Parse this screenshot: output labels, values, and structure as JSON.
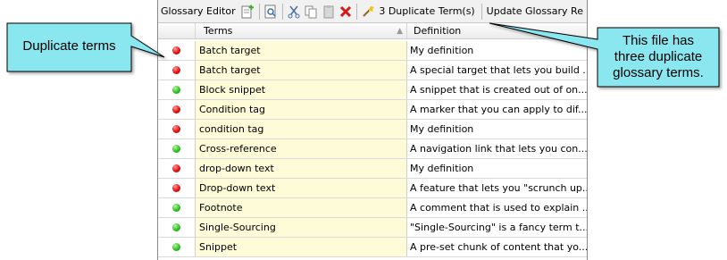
{
  "toolbar": {
    "title": "Glossary Editor",
    "duplicate_label": "3 Duplicate Term(s)",
    "update_label": "Update Glossary Re",
    "icons": [
      "add-term-icon",
      "preview-icon",
      "cut-icon",
      "copy-icon",
      "paste-icon",
      "delete-icon",
      "duplicate-terms-icon"
    ]
  },
  "table": {
    "columns": [
      "Terms",
      "Definition"
    ],
    "rows": [
      {
        "status": "red",
        "term": "Batch target",
        "definition": "My definition"
      },
      {
        "status": "red",
        "term": "Batch target",
        "definition": "A special target that lets you build ..."
      },
      {
        "status": "green",
        "term": "Block snippet",
        "definition": "A snippet that is created out of on..."
      },
      {
        "status": "red",
        "term": "Condition tag",
        "definition": "A marker that you can apply to dif..."
      },
      {
        "status": "red",
        "term": "condition tag",
        "definition": "My definition"
      },
      {
        "status": "green",
        "term": "Cross-reference",
        "definition": "A navigation link that lets you con..."
      },
      {
        "status": "red",
        "term": "drop-down text",
        "definition": "My definition"
      },
      {
        "status": "red",
        "term": "Drop-down text",
        "definition": "A feature that lets you \"scrunch up..."
      },
      {
        "status": "green",
        "term": "Footnote",
        "definition": "A comment that is used to explain ..."
      },
      {
        "status": "green",
        "term": "Single-Sourcing",
        "definition": "\"Single-Sourcing\" is a fancy term t..."
      },
      {
        "status": "green",
        "term": "Snippet",
        "definition": "A pre-set chunk of content that yo..."
      }
    ]
  },
  "callouts": {
    "left": "Duplicate terms",
    "right_line1": "This file has",
    "right_line2": "three duplicate",
    "right_line3": "glossary terms."
  },
  "colors": {
    "callout_fill": "#8ae6ef",
    "term_bg": "#fdfbd8",
    "dup_red": "#e31010",
    "ok_green": "#2fc21f"
  }
}
